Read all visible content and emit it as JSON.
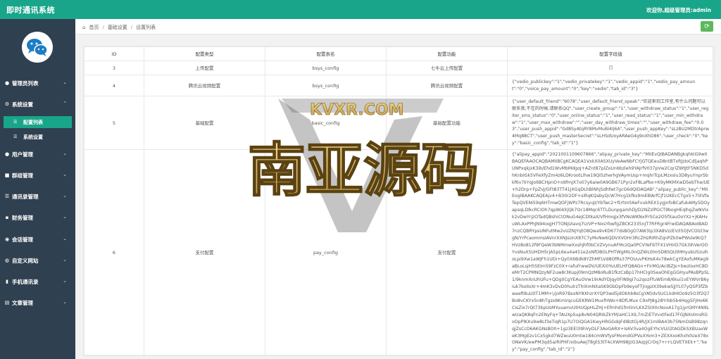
{
  "header": {
    "brand": "即时通讯系统",
    "welcome": "欢迎你,超级管理员:admin"
  },
  "sidebar": {
    "items": [
      {
        "label": "管理员列表",
        "icon": "person-icon"
      },
      {
        "label": "系统设置",
        "icon": "gear-icon"
      },
      {
        "label": "用户管理",
        "icon": "person-icon"
      },
      {
        "label": "群组管理",
        "icon": "group-icon"
      },
      {
        "label": "通讯录管理",
        "icon": "list-icon"
      },
      {
        "label": "财务管理",
        "icon": "book-icon"
      },
      {
        "label": "会话管理",
        "icon": "chat-icon"
      },
      {
        "label": "自定义网站",
        "icon": "globe-icon"
      },
      {
        "label": "手机通讯录",
        "icon": "phone-icon"
      },
      {
        "label": "文章管理",
        "icon": "doc-icon"
      }
    ],
    "subitems": [
      {
        "label": "配置列表",
        "active": true
      },
      {
        "label": "系统设置",
        "active": false
      }
    ]
  },
  "breadcrumb": {
    "home": "首页",
    "sep": "/",
    "level1": "基础设置",
    "level2": "设置列表"
  },
  "table": {
    "headers": [
      "ID",
      "配置类型",
      "配置表名",
      "配置功能",
      "配置字段值"
    ],
    "rows": [
      {
        "id": "3",
        "type": "上传配置",
        "table": "bsys_config",
        "func": "七牛云上传配置",
        "value": "[]"
      },
      {
        "id": "4",
        "type": "腾讯云视频配置",
        "table": "bsys_config",
        "func": "腾讯云视频配置",
        "value": "{\"vedio_publickey\":\"1\",\"vedio_privatekey\":\"1\",\"vedio_appid\":\"1\",\"vedio_pay_amount\":\"0\",\"voice_pay_amount\":\"0\",\"key\":\"vedio\",\"tab_id\":\"3\"}"
      },
      {
        "id": "5",
        "type": "基础配置",
        "table": "basic_config",
        "func": "基础配置功能",
        "value": "{\"user_default_friend\":\"6078\",\"user_default_friend_speak\":\"欢迎来到工作室,有什么问题可以联系我,不在的时候,请联系QQ\",\"user_create_group\":\"1\",\"user_withdraw_status\":\"1\",\"user_regiter_sms_status\":\"0\",\"user_online_status\":\"1\",\"user_read_status\":\"1\",\"user_min_withdraw\":\"1\",\"user_max_withdraw\":\"\",\"user_day_withdraw_times\":\"\",\"user_withdraw_fee\":\"0.03\",\"user_push_appid\":\"Gd8SyAtqRY8MvMuBI4lj6A\",\"user_push_appKey\":\"sLzBU2MDtrAprw4Mq88CT\",\"user_push_masterSecret\":\"sLHSdUoyARAeG4g9oXhD86\",\"user_check\":\"0\",\"key\":\"basic_config\",\"tab_id\":\"1\"}"
      },
      {
        "id": "6",
        "type": "支付配置",
        "table": "pay_config",
        "func": "支付配置",
        "value": "{\"alipay_appid\":\"2021001109607866\",\"alipay_private_key\":\"MIIEvQIBADANBgkqhkiG9w0BAQEFAAOCAQBAMIIBCgKCAQEA1VxkX0ASXUyVeAwNbFCYjGTQEeuD8ntBTxRJzIoCdljaqhPUNPxqkjxK3ib/Ehd1WvMbMdgoJ+AZnt87pIZoUn6bzleh9YAJrfV037pVw2CqriZWtJtF5NKD5dhKnbIGk5VFeXfyZm4z6LDKrootLlhw19QI5zherhgVAymUsp+mqhrTcpLMzxsIu3D8yuYnprSbkf6v7kYqJo6BCHpnO+o9fmJX7o07y6aiw0A9GB671Pyr2xF8LaPbo+K9yMKMXwD5ebThe/UE+h2Drp+FpZvJ/GFt83TT41JXGqDLhBlNhjSdhfwt7gcG6dQIDAQAB\",\"alipay_public_key\":\"MIIEogIBAAKCAQEAjv4+B30r2DF+siRqKQabyQcW7Hcg1kfks9mE8lArfCjf1UKEcCTgx5+7lXVfaTepQVENI59q6HTmwQOFjWPz7RcsyuJI/YbTwc2+fLYtmS6eFvukREX1ygjnfoBCafukAMy5DOyapsqLDlkcRCIOh7qpWi4XjQk7Oc18Mqc6TTLDunpgamhDj/D2NZzlPGCT9bogHEqlhgZwNVIxk2vDwYrjzOTadQBshiCtONuG4eJCDtkaX/VfHmqJx3fVNsWKNxlFrSCe2O5fXauOoYXz+jKAHvuWLAxPPhJN94oqjH7TONjUIavq7U/VP+NxsYbwfgZBCK2335nJT7RFRgr4FrwIDAQABAoIBAD7nzCQBRYpsUNFutMw2vUZNjYqtO8Qwa9vKD677dsBOgO7AW3ip3XA8VzzEV/I5OJVCOlzl3wgN/YrPcaommsIAVnrXXNJsUnX87C7yMvNw6QDVXVOHr3RcZHzRIRhZqnPZk0wPWsle9kQ7HVz8o812f9FQeW3bNMmwXxshJhf0bCVZVynuAFMczQa0PCVYeFbTFX1VHIrD7Gk3IhVerOOYvsNuX5UHDH5rjA5pL6eu4a451e2oNfOBGLPHTWgMiL0nQZWL0lmSD8SQUtMHyubU5zuIhoLpi9Xw1aWJFh1UDi+Qy0X6Bdk8YZhMFLVd8OfRs37POUuvPKHsK4v78wkCgYEAxfuMKeg9aBLoLsjH5SEIm59FzC0X+rafuFrwwDV/UEXi0YuUELHFQ8AGn+FIrMG/AclBZJs+bwzloxHC8DeMrT2CPMNQzyNF2uw8r3Kupj09mQzM8oRuB1fkzCsBp17hHCIg0SeaOhEgGGHyuPAsBPpSL1/9knmXnUhUFu+QDg0CgYEAuOVw19rAdYDjqy0FIN9gI7u2qozFfuWEm8/6kui1vEYWVrB6yiuk7koIloXr+4mK3vDvD0hulrzThIXmNXaSK9GbDpFb9eyoFTjngpIX39ekwSjJYL07yQSP3fZbwaeft8uUitT1MM+\\/joR97BsxNY8XhzrXYQP3wd5jdObhb8sCgYAf/dvSUCLkdHIOo9z5O3f2Q7Bo8vCKYx5n8hTgzs9KmVqcuGEKRW1MuxfHWo+8DfLMux C9xPJ8g28Yrbb5b4Hqg5FJHo6KCisZix7rQt73bpUsMYuuamvUtHUQpHLZHj+Efmhd1fmlinrLKXZSIX0cNooA17g1jyrGMY4N9LwUaQK8qFn2ENyFq+TAUXpSup8vN04QRIkZkYM/aHC1XIL7rnZiETVvxtFed17FGJNXolmsRGoOpPlKXu9w8Lf3eTiqR1p7U7OiQGA1KwyHRGGdqFdIBztGj4R/JX1mIBA43b75NmOsB98zqnqjZsCcD6AKGNsBO0+1gz3EEl39hVyDLF3AoGARX+Is6V3va4OgEYhcVU/i2tAGDkSXBUaxWeK3MgEzv1Cx5gkd7WZwuU0mtw184cmWVfysFMomdGlPVuXYom3+ZEXXxoKhxh0UeX78xONeVK/ewPM3qd5a/RiPHF/xibuAwjT8gtS3tT4cXWH98JzG3AzpJCrOq7+r+LQVETXEk+\",\"key\":\"pay_config\",\"tab_id\":\"2\"}"
      }
    ]
  },
  "watermark": {
    "site": "KVXR.COM",
    "title": "南亚源码"
  }
}
